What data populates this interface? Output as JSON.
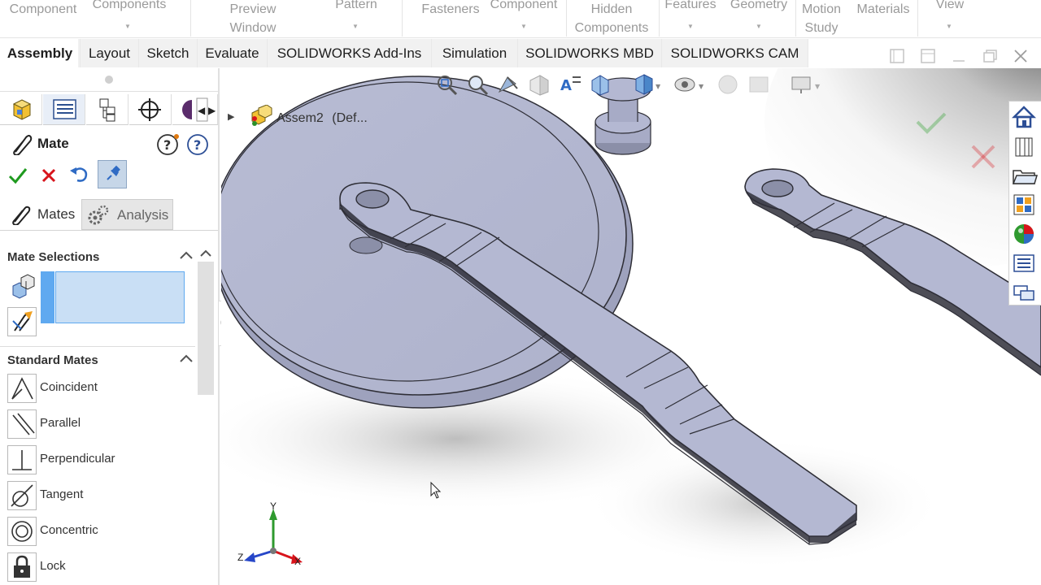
{
  "ribbon": {
    "items": [
      {
        "label": "Component",
        "has_arrow": false
      },
      {
        "label": "Components",
        "has_arrow": true
      },
      {
        "label": "Preview\nWindow",
        "has_arrow": false
      },
      {
        "label": "Pattern",
        "has_arrow": true
      },
      {
        "label": "Fasteners",
        "has_arrow": false
      },
      {
        "label": "Component",
        "has_arrow": true
      },
      {
        "label": "Hidden\nComponents",
        "has_arrow": false
      },
      {
        "label": "Features",
        "has_arrow": true
      },
      {
        "label": "Geometry",
        "has_arrow": true
      },
      {
        "label": "Motion\nStudy",
        "has_arrow": false
      },
      {
        "label": "Materials",
        "has_arrow": false
      },
      {
        "label": "View",
        "has_arrow": true
      }
    ]
  },
  "tabs": [
    "Assembly",
    "Layout",
    "Sketch",
    "Evaluate",
    "SOLIDWORKS Add-Ins",
    "Simulation",
    "SOLIDWORKS MBD",
    "SOLIDWORKS CAM"
  ],
  "active_tab": "Assembly",
  "panel": {
    "title": "Mate",
    "subtabs": {
      "mates": "Mates",
      "analysis": "Analysis"
    },
    "mate_selections": {
      "title": "Mate Selections",
      "value": ""
    },
    "standard_mates": {
      "title": "Standard Mates",
      "items": [
        "Coincident",
        "Parallel",
        "Perpendicular",
        "Tangent",
        "Concentric",
        "Lock"
      ]
    }
  },
  "viewport": {
    "tree_label": "Assem2",
    "tree_config": "(Def...",
    "triad": {
      "x": "X",
      "y": "Y",
      "z": "Z"
    }
  },
  "colors": {
    "part_fill": "#b4b8d2",
    "part_edge": "#2e2e36",
    "accept": "#1f9a1f",
    "cancel": "#d8141b",
    "selection_box": "#c9dff5",
    "selection_bar": "#5fa9f0"
  }
}
